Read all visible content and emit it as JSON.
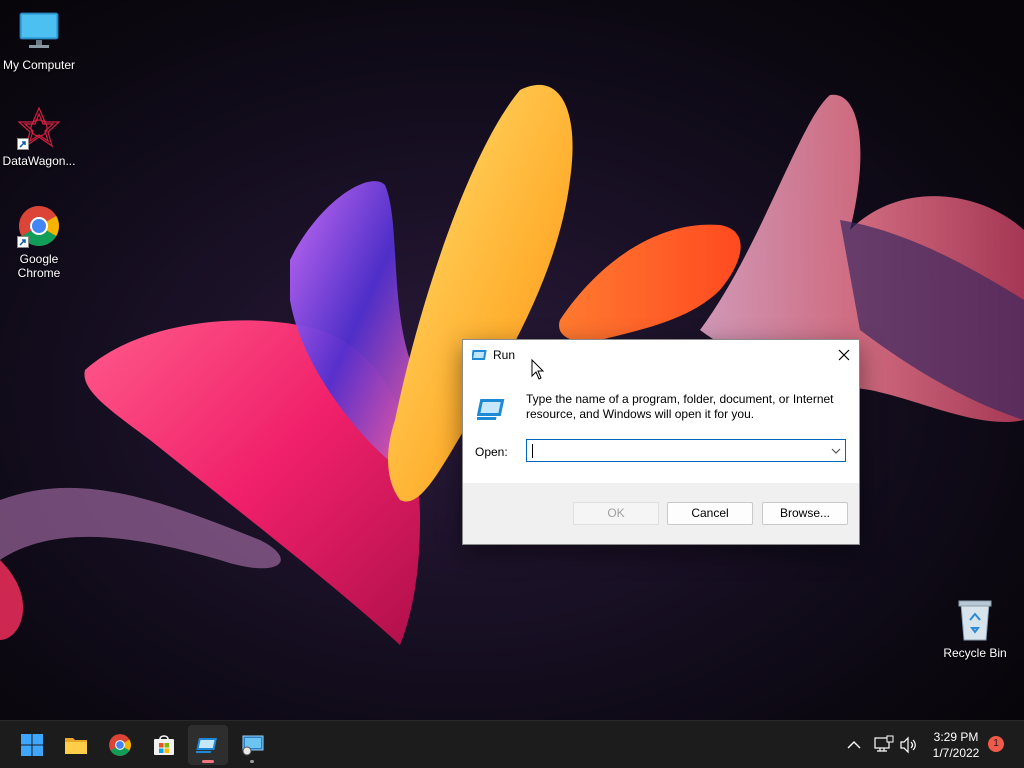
{
  "desktop": {
    "icons": [
      {
        "label": "My Computer"
      },
      {
        "label": "DataWagon..."
      },
      {
        "label": "Google\nChrome"
      },
      {
        "label": "Recycle Bin"
      }
    ]
  },
  "run_dialog": {
    "title": "Run",
    "description": "Type the name of a program, folder, document, or Internet resource, and Windows will open it for you.",
    "open_label": "Open:",
    "open_value": "",
    "buttons": {
      "ok": "OK",
      "cancel": "Cancel",
      "browse": "Browse..."
    },
    "ok_enabled": false
  },
  "taskbar": {
    "apps": [
      {
        "icon": "windows-start-icon"
      },
      {
        "icon": "file-explorer-icon"
      },
      {
        "icon": "chrome-icon"
      },
      {
        "icon": "microsoft-store-icon"
      },
      {
        "icon": "run-icon",
        "active": true
      },
      {
        "icon": "remote-desktop-icon"
      }
    ],
    "clock": {
      "time": "3:29 PM",
      "date": "1/7/2022"
    },
    "notification_count": "1"
  },
  "colors": {
    "accent": "#0067c0",
    "taskbar_bg": "#1c1c1c",
    "notification_badge": "#f05a4a"
  }
}
